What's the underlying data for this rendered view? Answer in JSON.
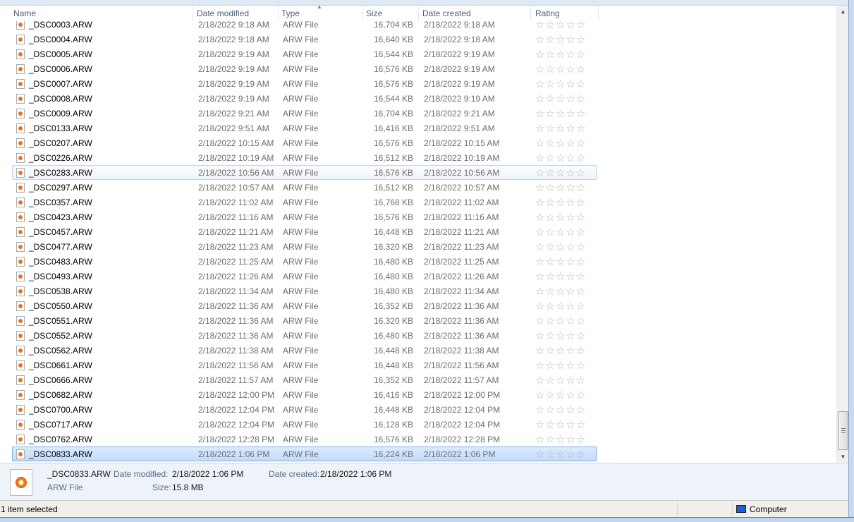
{
  "columns": {
    "name": "Name",
    "date_modified": "Date modified",
    "type": "Type",
    "size": "Size",
    "date_created": "Date created",
    "rating": "Rating"
  },
  "files": [
    [
      "_DSC0003.ARW",
      "2/18/2022 9:18 AM",
      "ARW File",
      "16,704 KB",
      "2/18/2022 9:18 AM"
    ],
    [
      "_DSC0004.ARW",
      "2/18/2022 9:18 AM",
      "ARW File",
      "16,640 KB",
      "2/18/2022 9:18 AM"
    ],
    [
      "_DSC0005.ARW",
      "2/18/2022 9:19 AM",
      "ARW File",
      "16,544 KB",
      "2/18/2022 9:19 AM"
    ],
    [
      "_DSC0006.ARW",
      "2/18/2022 9:19 AM",
      "ARW File",
      "16,576 KB",
      "2/18/2022 9:19 AM"
    ],
    [
      "_DSC0007.ARW",
      "2/18/2022 9:19 AM",
      "ARW File",
      "16,576 KB",
      "2/18/2022 9:19 AM"
    ],
    [
      "_DSC0008.ARW",
      "2/18/2022 9:19 AM",
      "ARW File",
      "16,544 KB",
      "2/18/2022 9:19 AM"
    ],
    [
      "_DSC0009.ARW",
      "2/18/2022 9:21 AM",
      "ARW File",
      "16,704 KB",
      "2/18/2022 9:21 AM"
    ],
    [
      "_DSC0133.ARW",
      "2/18/2022 9:51 AM",
      "ARW File",
      "16,416 KB",
      "2/18/2022 9:51 AM"
    ],
    [
      "_DSC0207.ARW",
      "2/18/2022 10:15 AM",
      "ARW File",
      "16,576 KB",
      "2/18/2022 10:15 AM"
    ],
    [
      "_DSC0226.ARW",
      "2/18/2022 10:19 AM",
      "ARW File",
      "16,512 KB",
      "2/18/2022 10:19 AM"
    ],
    [
      "_DSC0283.ARW",
      "2/18/2022 10:56 AM",
      "ARW File",
      "16,576 KB",
      "2/18/2022 10:56 AM"
    ],
    [
      "_DSC0297.ARW",
      "2/18/2022 10:57 AM",
      "ARW File",
      "16,512 KB",
      "2/18/2022 10:57 AM"
    ],
    [
      "_DSC0357.ARW",
      "2/18/2022 11:02 AM",
      "ARW File",
      "16,768 KB",
      "2/18/2022 11:02 AM"
    ],
    [
      "_DSC0423.ARW",
      "2/18/2022 11:16 AM",
      "ARW File",
      "16,576 KB",
      "2/18/2022 11:16 AM"
    ],
    [
      "_DSC0457.ARW",
      "2/18/2022 11:21 AM",
      "ARW File",
      "16,448 KB",
      "2/18/2022 11:21 AM"
    ],
    [
      "_DSC0477.ARW",
      "2/18/2022 11:23 AM",
      "ARW File",
      "16,320 KB",
      "2/18/2022 11:23 AM"
    ],
    [
      "_DSC0483.ARW",
      "2/18/2022 11:25 AM",
      "ARW File",
      "16,480 KB",
      "2/18/2022 11:25 AM"
    ],
    [
      "_DSC0493.ARW",
      "2/18/2022 11:26 AM",
      "ARW File",
      "16,480 KB",
      "2/18/2022 11:26 AM"
    ],
    [
      "_DSC0538.ARW",
      "2/18/2022 11:34 AM",
      "ARW File",
      "16,480 KB",
      "2/18/2022 11:34 AM"
    ],
    [
      "_DSC0550.ARW",
      "2/18/2022 11:36 AM",
      "ARW File",
      "16,352 KB",
      "2/18/2022 11:36 AM"
    ],
    [
      "_DSC0551.ARW",
      "2/18/2022 11:36 AM",
      "ARW File",
      "16,320 KB",
      "2/18/2022 11:36 AM"
    ],
    [
      "_DSC0552.ARW",
      "2/18/2022 11:36 AM",
      "ARW File",
      "16,480 KB",
      "2/18/2022 11:36 AM"
    ],
    [
      "_DSC0562.ARW",
      "2/18/2022 11:38 AM",
      "ARW File",
      "16,448 KB",
      "2/18/2022 11:38 AM"
    ],
    [
      "_DSC0661.ARW",
      "2/18/2022 11:56 AM",
      "ARW File",
      "16,448 KB",
      "2/18/2022 11:56 AM"
    ],
    [
      "_DSC0666.ARW",
      "2/18/2022 11:57 AM",
      "ARW File",
      "16,352 KB",
      "2/18/2022 11:57 AM"
    ],
    [
      "_DSC0682.ARW",
      "2/18/2022 12:00 PM",
      "ARW File",
      "16,416 KB",
      "2/18/2022 12:00 PM"
    ],
    [
      "_DSC0700.ARW",
      "2/18/2022 12:04 PM",
      "ARW File",
      "16,448 KB",
      "2/18/2022 12:04 PM"
    ],
    [
      "_DSC0717.ARW",
      "2/18/2022 12:04 PM",
      "ARW File",
      "16,128 KB",
      "2/18/2022 12:04 PM"
    ],
    [
      "_DSC0762.ARW",
      "2/18/2022 12:28 PM",
      "ARW File",
      "16,576 KB",
      "2/18/2022 12:28 PM"
    ],
    [
      "_DSC0833.ARW",
      "2/18/2022 1:06 PM",
      "ARW File",
      "16,224 KB",
      "2/18/2022 1:06 PM"
    ]
  ],
  "hover_index": 10,
  "selected_index": 29,
  "rating_glyph": "☆☆☆☆☆",
  "details": {
    "name": "_DSC0833.ARW",
    "type": "ARW File",
    "date_modified_label": "Date modified:",
    "date_modified": "2/18/2022 1:06 PM",
    "date_created_label": "Date created:",
    "date_created": "2/18/2022 1:06 PM",
    "size_label": "Size:",
    "size": "15.8 MB"
  },
  "status": {
    "selection": "1 item selected",
    "location": "Computer"
  }
}
